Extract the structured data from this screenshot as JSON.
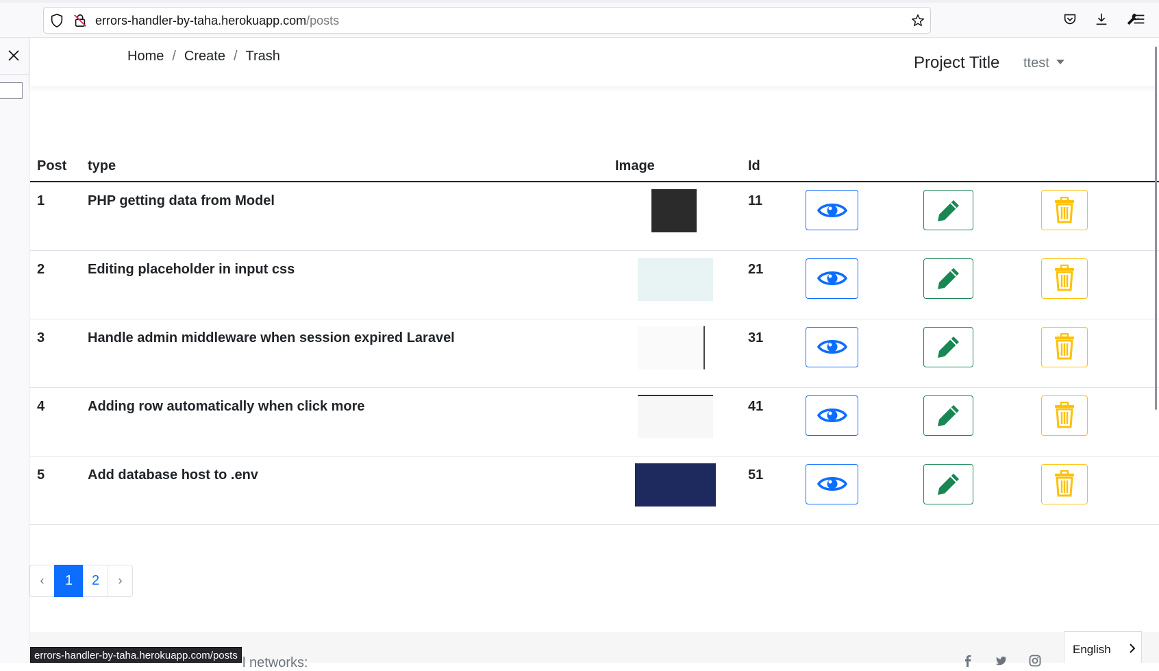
{
  "browser": {
    "url_host": "errors-handler-by-taha.herokuapp.com",
    "url_path": "/posts",
    "status_url": "errors-handler-by-taha.herokuapp.com/posts"
  },
  "breadcrumb": {
    "home": "Home",
    "create": "Create",
    "trash": "Trash",
    "separator": "/"
  },
  "navbar": {
    "project_title": "Project Title",
    "user": "ttest"
  },
  "table": {
    "headers": {
      "post": "Post",
      "type": "type",
      "image": "Image",
      "id": "Id"
    },
    "rows": [
      {
        "post": "1",
        "type": "PHP getting data from Model",
        "id": "11",
        "thumb": "dark"
      },
      {
        "post": "2",
        "type": "Editing placeholder in input css",
        "id": "21",
        "thumb": "light"
      },
      {
        "post": "3",
        "type": "Handle admin middleware when session expired Laravel",
        "id": "31",
        "thumb": "paper"
      },
      {
        "post": "4",
        "type": "Adding row automatically when click more",
        "id": "41",
        "thumb": "form"
      },
      {
        "post": "5",
        "type": "Add database host to .env",
        "id": "51",
        "thumb": "navy"
      }
    ]
  },
  "pagination": {
    "prev": "‹",
    "pages": [
      "1",
      "2"
    ],
    "next": "›",
    "current": "1"
  },
  "footer": {
    "social_text": "l networks:",
    "language": "English"
  },
  "colors": {
    "primary": "#0d6efd",
    "success": "#198754",
    "warning": "#ffc107"
  }
}
